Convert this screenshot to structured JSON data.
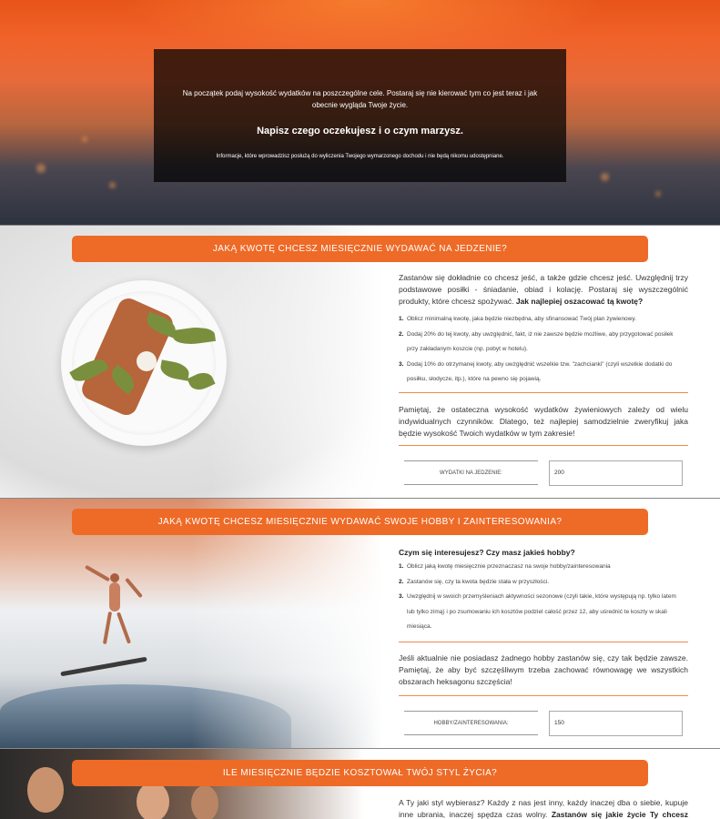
{
  "hero": {
    "intro": "Na początek podaj wysokość wydatków na poszczególne cele. Postaraj się nie kierować tym co jest teraz i jak obecnie wygląda Twoje życie.",
    "title": "Napisz czego oczekujesz i o czym marzysz.",
    "note": "Informacje, które wprowadzisz posłużą do wyliczenia Twojego wymarzonego dochodu i nie będą nikomu udostępniane."
  },
  "food": {
    "banner": "JAKĄ KWOTĘ CHCESZ MIESIĘCZNIE WYDAWAĆ NA JEDZENIE?",
    "intro_plain": "Zastanów się dokładnie co chcesz jeść, a także gdzie chcesz jeść. Uwzględnij trzy podstawowe posiłki - śniadanie, obiad i kolację. Postaraj się wyszczególnić produkty, które chcesz spożywać.",
    "intro_bold": "Jak najlepiej oszacować tą kwotę?",
    "steps": [
      {
        "num": "1.",
        "text": "Oblicz minimalną kwotę, jaka będzie niezbędna, aby sfinansować Twój plan żywienowy."
      },
      {
        "num": "2.",
        "text": "Dodaj 20% do tej kwoty, aby uwzględnić, fakt, iż nie zawsze będzie możliwe, aby przygotować posiłek"
      },
      {
        "num": "",
        "text": "przy zakładanym koszcie (np. pobyt w hotelu)."
      },
      {
        "num": "3.",
        "text": "Dodaj 10% do otrzymanej kwoty, aby uwzględnić wszelkie tzw. \"zachcianki\" (czyli wszelkie dodatki do"
      },
      {
        "num": "",
        "text": "posiłku, słodycze, itp.), które na pewno się pojawią."
      }
    ],
    "closing": "Pamiętaj, że ostateczna wysokość wydatków żywieniowych zależy od wielu indywidualnych czynników. Dlatego, też najlepiej samodzielnie zweryfikuj jaka będzie wysokość Twoich wydatków w tym zakresie!",
    "field_label": "WYDATKI NA JEDZENIE:",
    "field_value": "200"
  },
  "hobby": {
    "banner": "JAKĄ KWOTĘ CHCESZ MIESIĘCZNIE WYDAWAĆ SWOJE HOBBY I ZAINTERESOWANIA?",
    "question": "Czym się interesujesz? Czy masz jakieś hobby?",
    "steps": [
      {
        "num": "1.",
        "text": "Oblicz jaką kwotę miesięcznie przeznaczasz na swoje hobby/zainteresowania"
      },
      {
        "num": "2.",
        "text": "Zastanów się, czy ta kwota będzie stała w przyszłości."
      },
      {
        "num": "3.",
        "text": "Uwzględnij w swoich przemyśleniach aktywności sezonowe (czyli takie, które występują np. tylko latem"
      },
      {
        "num": "",
        "text": "lub tylko zimą) i po zsumowaniu ich kosztów podziel całość przez 12, aby uśrednić te koszty w skali"
      },
      {
        "num": "",
        "text": "miesiąca."
      }
    ],
    "closing": "Jeśli aktualnie nie posiadasz żadnego hobby zastanów się, czy tak będzie zawsze. Pamiętaj, że aby być szczęśliwym trzeba zachować równowagę we wszystkich obszarach heksagonu szczęścia!",
    "field_label": "HOBBY/ZAINTERESOWANIA:",
    "field_value": "150"
  },
  "lifestyle": {
    "banner": "ILE MIESIĘCZNIE BĘDZIE KOSZTOWAŁ TWÓJ STYL ŻYCIA?",
    "intro_plain": "A Ty jaki styl wybierasz? Każdy z nas jest inny, każdy inaczej dba o siebie, kupuje inne ubrania, inaczej spędza czas wolny.",
    "intro_bold": "Zastanów się jakie życie Ty chcesz prowadzić."
  },
  "colors": {
    "accent": "#ee6a27",
    "rule": "#ee8a4a"
  }
}
